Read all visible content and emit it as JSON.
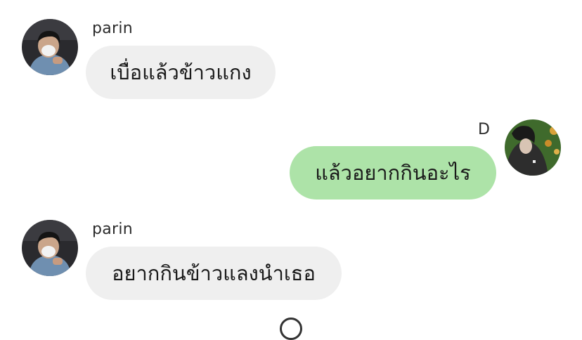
{
  "messages": [
    {
      "sender": "parin",
      "direction": "incoming",
      "text": "เบื่อแล้วข้าวแกง",
      "avatar_icon": "user-avatar-icon"
    },
    {
      "sender": "D",
      "direction": "outgoing",
      "text": "แล้วอยากกินอะไร",
      "avatar_icon": "user-avatar-icon"
    },
    {
      "sender": "parin",
      "direction": "incoming",
      "text": "อยากกินข้าวแลงนำเธอ",
      "avatar_icon": "user-avatar-icon"
    }
  ],
  "colors": {
    "incoming_bubble": "#efefef",
    "outgoing_bubble": "#ade3a8",
    "text": "#1a1a1a"
  }
}
